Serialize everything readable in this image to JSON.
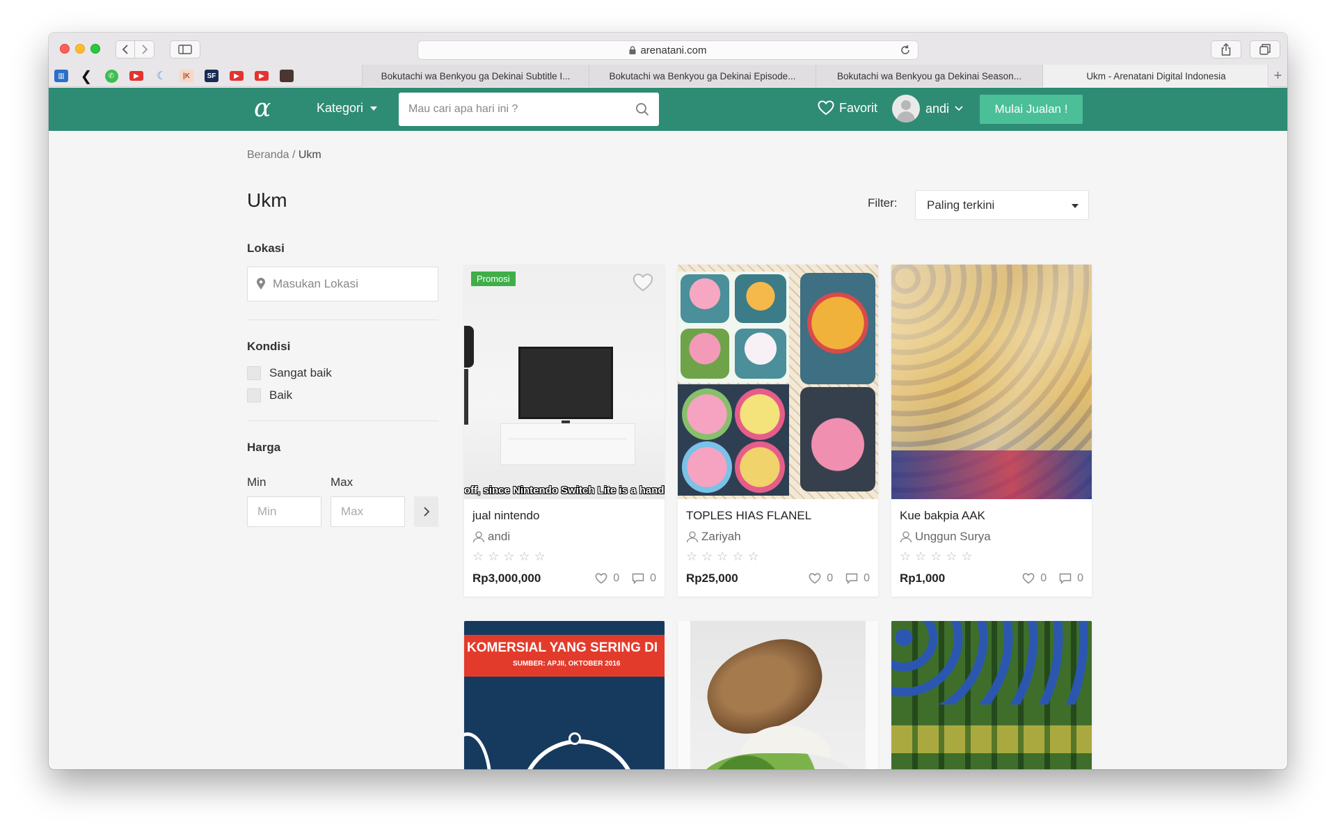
{
  "browser": {
    "url": "arenatani.com",
    "bookmarks": [
      "trello-bookmark",
      "back-arrow-bookmark",
      "whatsapp-bookmark",
      "youtube-bookmark",
      "app-bookmark",
      "hk-bookmark",
      "sf-bookmark",
      "youtube-bookmark-2",
      "youtube-bookmark-3",
      "photo-bookmark"
    ],
    "tabs": [
      {
        "label": "Bokutachi wa Benkyou ga Dekinai Subtitle I...",
        "active": false
      },
      {
        "label": "Bokutachi wa Benkyou ga Dekinai Episode...",
        "active": false
      },
      {
        "label": "Bokutachi wa Benkyou ga Dekinai Season...",
        "active": false
      },
      {
        "label": "Ukm - Arenatani Digital Indonesia",
        "active": true
      }
    ]
  },
  "header": {
    "logo": "α",
    "kategori": "Kategori",
    "search_placeholder": "Mau cari apa hari ini ?",
    "favorit": "Favorit",
    "username": "andi",
    "cta": "Mulai Jualan !",
    "brand_color": "#2e8b74",
    "cta_color": "#4bbf98"
  },
  "breadcrumb": {
    "home": "Beranda",
    "sep": " / ",
    "current": "Ukm"
  },
  "page_title": "Ukm",
  "filter": {
    "label": "Filter:",
    "selected": "Paling terkini"
  },
  "sidebar": {
    "lokasi_title": "Lokasi",
    "lokasi_placeholder": "Masukan Lokasi",
    "kondisi_title": "Kondisi",
    "kondisi_options": [
      "Sangat baik",
      "Baik"
    ],
    "harga_title": "Harga",
    "min_label": "Min",
    "max_label": "Max",
    "min_placeholder": "Min",
    "max_placeholder": "Max"
  },
  "products": [
    {
      "title": "jual nintendo",
      "seller": "andi",
      "price": "Rp3,000,000",
      "likes": "0",
      "comments": "0",
      "promo": "Promosi",
      "rating": 0,
      "image": "tv-on-stand",
      "caption": "off, since Nintendo Switch Lite is a handheld device, it won't connect to"
    },
    {
      "title": "TOPLES HIAS FLANEL",
      "seller": "Zariyah",
      "price": "Rp25,000",
      "likes": "0",
      "comments": "0",
      "rating": 0,
      "image": "decorated-jars-collage"
    },
    {
      "title": "Kue bakpia AAK",
      "seller": "Unggun Surya",
      "price": "Rp1,000",
      "likes": "0",
      "comments": "0",
      "rating": 0,
      "image": "bakpia-boxes"
    },
    {
      "image": "komersial-poster",
      "banner": "KOMERSIAL YANG SERING DI",
      "sub": "SUMBER: APJII, OKTOBER 2016"
    },
    {
      "image": "fried-fish-rice"
    },
    {
      "image": "green-bottles"
    }
  ]
}
